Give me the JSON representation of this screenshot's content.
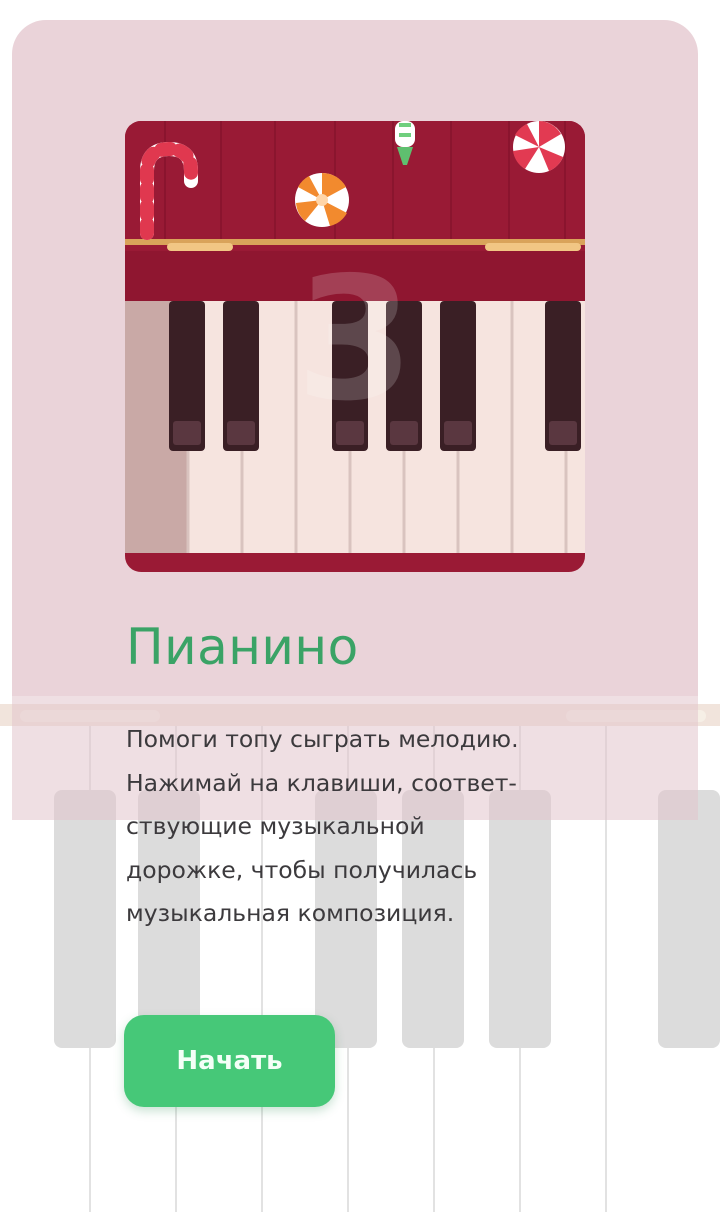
{
  "game": {
    "step_number": "3",
    "title": "Пианино",
    "description_lines": [
      "Помоги топу сыграть мелодию.",
      "Нажимай на клавиши, соответ-",
      "ствующие музыкальной",
      "дорожке, чтобы получилась",
      "музыкальная композиция."
    ],
    "start_label": "Начать"
  },
  "colors": {
    "card_background": "#ead3d9",
    "title_green": "#3aa366",
    "button_green": "#46c878",
    "piano_red": "#9a1a35",
    "text_dark": "#3c3a3d"
  },
  "icons": [
    "candy-cane-icon",
    "peppermint-candy-icon",
    "orange-swirl-candy-icon",
    "wrapped-candy-icon"
  ]
}
